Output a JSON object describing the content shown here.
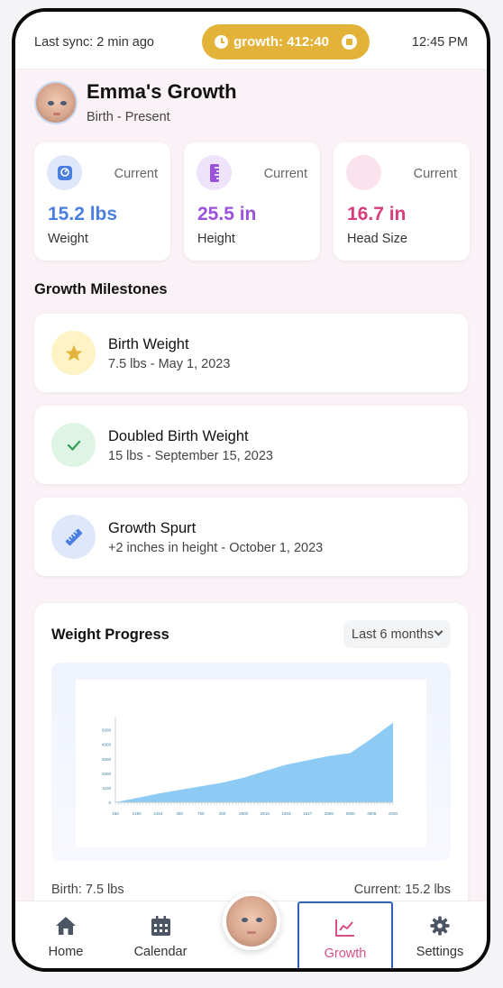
{
  "status": {
    "last_sync": "Last sync: 2 min ago",
    "timer": "growth: 412:40",
    "time": "12:45 PM"
  },
  "profile": {
    "name": "Emma's Growth",
    "range": "Birth - Present"
  },
  "stats": [
    {
      "label": "Weight",
      "value": "15.2 lbs",
      "current": "Current",
      "color": "#4a7fe0",
      "icon": "scale-icon"
    },
    {
      "label": "Height",
      "value": "25.5 in",
      "current": "Current",
      "color": "#9a52d9",
      "icon": "ruler-icon"
    },
    {
      "label": "Head Size",
      "value": "16.7 in",
      "current": "Current",
      "color": "#d63d7c",
      "icon": "head-icon"
    }
  ],
  "milestones_title": "Growth Milestones",
  "milestones": [
    {
      "title": "Birth Weight",
      "subtitle": "7.5 lbs - May 1, 2023",
      "icon": "star-icon",
      "bg": "#fdf3c4",
      "color": "#e3b238"
    },
    {
      "title": "Doubled Birth Weight",
      "subtitle": "15 lbs - September 15, 2023",
      "icon": "check-icon",
      "bg": "#def5e5",
      "color": "#3aa35a"
    },
    {
      "title": "Growth Spurt",
      "subtitle": "+2 inches in height - October 1, 2023",
      "icon": "ruler-icon",
      "bg": "#dfe8fb",
      "color": "#4a7fe0"
    }
  ],
  "chart": {
    "title": "Weight Progress",
    "range": "Last 6 months",
    "foot_left": "Birth: 7.5 lbs",
    "foot_right": "Current: 15.2 lbs"
  },
  "chart_data": {
    "type": "area",
    "x": [
      "150",
      "2160",
      "2164",
      "400",
      "759",
      "250",
      "2600",
      "2515",
      "1503",
      "1517",
      "2566",
      "2860",
      "2608",
      "2020"
    ],
    "values": [
      0,
      300,
      600,
      850,
      1100,
      1350,
      1700,
      2150,
      2600,
      2900,
      3200,
      3400,
      4400,
      5500
    ],
    "y_ticks": [
      "5000",
      "4000",
      "3000",
      "2000",
      "1100",
      "0"
    ],
    "ylim": [
      0,
      5600
    ],
    "color": "#8ecbf4",
    "grid": false
  },
  "nav": {
    "home": "Home",
    "calendar": "Calendar",
    "growth": "Growth",
    "settings": "Settings"
  }
}
